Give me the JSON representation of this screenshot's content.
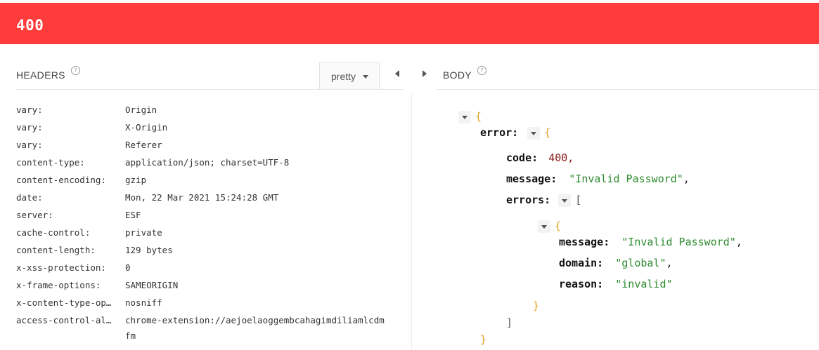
{
  "status": {
    "code": "400",
    "color": "#ff3c3c"
  },
  "headers_panel": {
    "title": "HEADERS",
    "format_label": "pretty",
    "rows": [
      {
        "name": "vary:",
        "value": "Origin"
      },
      {
        "name": "vary:",
        "value": "X-Origin"
      },
      {
        "name": "vary:",
        "value": "Referer"
      },
      {
        "name": "content-type:",
        "value": "application/json; charset=UTF-8"
      },
      {
        "name": "content-encoding:",
        "value": "gzip"
      },
      {
        "name": "date:",
        "value": "Mon, 22 Mar 2021 15:24:28 GMT"
      },
      {
        "name": "server:",
        "value": "ESF"
      },
      {
        "name": "cache-control:",
        "value": "private"
      },
      {
        "name": "content-length:",
        "value": "129 bytes"
      },
      {
        "name": "x-xss-protection:",
        "value": "0"
      },
      {
        "name": "x-frame-options:",
        "value": "SAMEORIGIN"
      },
      {
        "name": "x-content-type-op…",
        "value": "nosniff"
      },
      {
        "name": "access-control-al…",
        "value": "chrome-extension://aejoelaoggembcahagimdiliamlcdmfm"
      }
    ]
  },
  "body_panel": {
    "title": "BODY",
    "json": {
      "error_key": "error:",
      "code_key": "code:",
      "code_value": "400,",
      "message_key": "message:",
      "message_value": "\"Invalid Password\"",
      "errors_key": "errors:",
      "inner_message_key": "message:",
      "inner_message_value": "\"Invalid Password\"",
      "domain_key": "domain:",
      "domain_value": "\"global\"",
      "reason_key": "reason:",
      "reason_value": "\"invalid\""
    }
  },
  "icons": {
    "help": "help-circle-icon",
    "collapse": "chevron-left-icon",
    "expand": "chevron-right-icon",
    "toggle": "caret-down-icon"
  }
}
